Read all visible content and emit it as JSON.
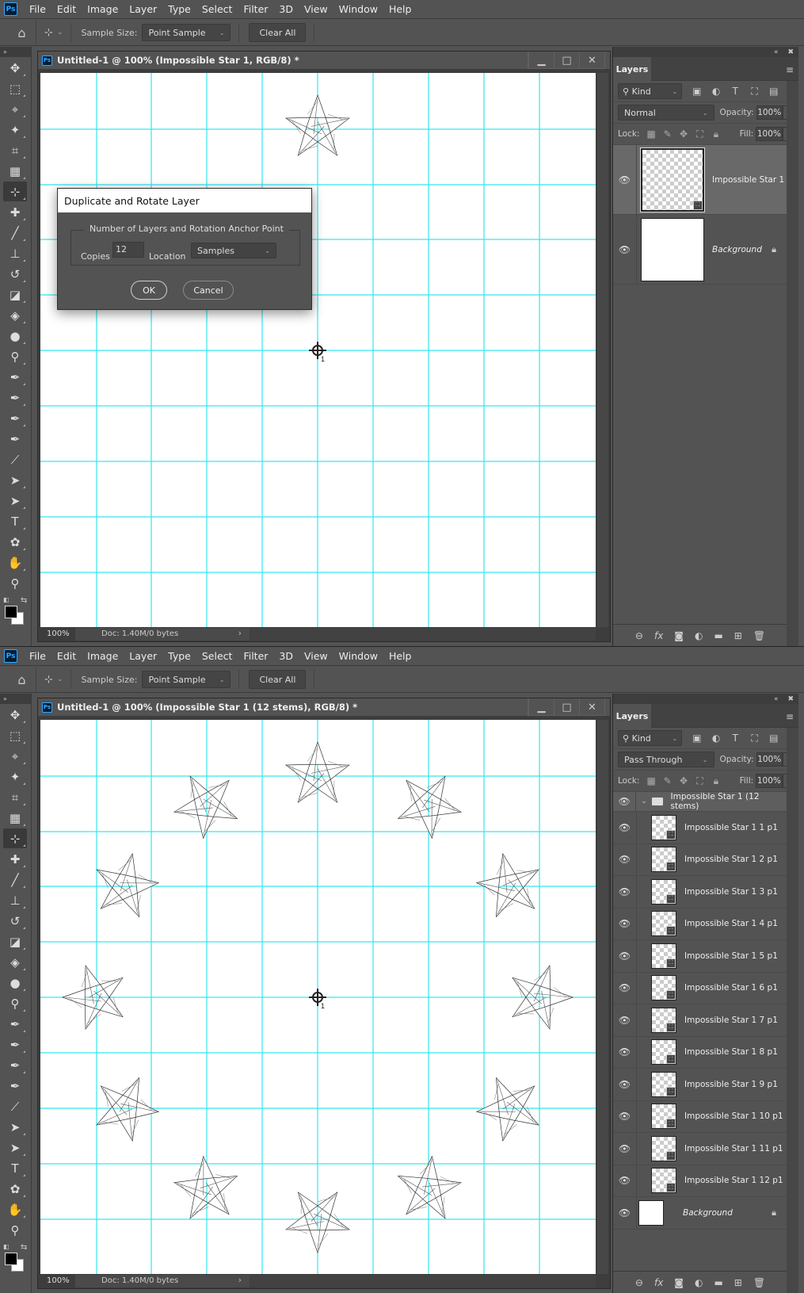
{
  "app": {
    "menu": [
      "File",
      "Edit",
      "Image",
      "Layer",
      "Type",
      "Select",
      "Filter",
      "3D",
      "View",
      "Window",
      "Help"
    ],
    "options": {
      "sample_size_label": "Sample Size:",
      "sample_size_value": "Point Sample",
      "clear_all": "Clear All"
    },
    "toolbar_collapse": "»",
    "tools": [
      "move-tool",
      "marquee-tool",
      "lasso-tool",
      "magic-wand-tool",
      "crop-tool",
      "frame-tool",
      "color-sampler-tool",
      "healing-brush-tool",
      "brush-tool",
      "clone-stamp-tool",
      "history-brush-tool",
      "eraser-tool",
      "paint-bucket-tool",
      "blur-tool",
      "dodge-tool",
      "pen-tool",
      "curvature-pen-tool",
      "add-anchor-point-tool",
      "delete-anchor-point-tool",
      "convert-point-tool",
      "path-selection-tool",
      "direct-selection-tool",
      "type-tool",
      "custom-shape-tool",
      "hand-tool",
      "zoom-tool"
    ],
    "tool_glyphs": [
      "✥",
      "⬚",
      "⌖",
      "✦",
      "⌗",
      "▦",
      "⊹",
      "✚",
      "╱",
      "⊥",
      "↺",
      "◪",
      "◈",
      "●",
      "⚲",
      "✒",
      "✒",
      "✒",
      "✒",
      "⟋",
      "➤",
      "➤",
      "T",
      "✿",
      "✋",
      "⚲"
    ],
    "colors": {
      "foreground": "#000000",
      "background": "#ffffff",
      "guide": "#33e6f0",
      "accent": "#31a8ff"
    }
  },
  "screen1": {
    "doc_title": "Untitled-1 @ 100% (Impossible Star 1, RGB/8) *",
    "zoom": "100%",
    "doc_info": "Doc: 1.40M/0 bytes",
    "dialog": {
      "title": "Duplicate and Rotate Layer",
      "group_label": "Number of Layers and Rotation Anchor Point",
      "copies_label": "Copies",
      "copies_value": "12",
      "location_label": "Location",
      "location_value": "Samples",
      "ok": "OK",
      "cancel": "Cancel"
    },
    "anchor_label": "1",
    "layers_panel": {
      "tab": "Layers",
      "kind": "Kind",
      "blend_mode": "Normal",
      "opacity_label": "Opacity:",
      "opacity": "100%",
      "lock_label": "Lock:",
      "fill_label": "Fill:",
      "fill": "100%",
      "layers": [
        {
          "name": "Impossible Star 1",
          "selected": true,
          "smart_object": true
        },
        {
          "name": "Background",
          "locked": true
        }
      ]
    }
  },
  "screen2": {
    "doc_title": "Untitled-1 @ 100% (Impossible Star 1 (12 stems), RGB/8) *",
    "zoom": "100%",
    "doc_info": "Doc: 1.40M/0 bytes",
    "anchor_label": "1",
    "star_count": 12,
    "layers_panel": {
      "tab": "Layers",
      "kind": "Kind",
      "blend_mode": "Pass Through",
      "opacity_label": "Opacity:",
      "opacity": "100%",
      "lock_label": "Lock:",
      "fill_label": "Fill:",
      "fill": "100%",
      "group": "Impossible Star 1 (12 stems)",
      "layers": [
        "Impossible Star 1 1 p1",
        "Impossible Star 1 2 p1",
        "Impossible Star 1 3 p1",
        "Impossible Star 1 4 p1",
        "Impossible Star 1 5 p1",
        "Impossible Star 1 6 p1",
        "Impossible Star 1 7 p1",
        "Impossible Star 1 8 p1",
        "Impossible Star 1 9 p1",
        "Impossible Star 1 10 p1",
        "Impossible Star 1 11 p1",
        "Impossible Star 1 12 p1"
      ],
      "background": "Background"
    }
  }
}
